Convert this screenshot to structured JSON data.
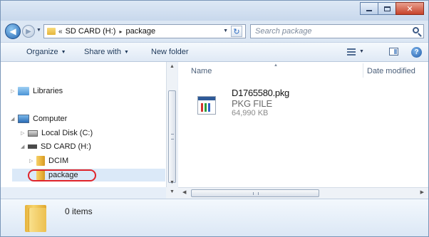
{
  "address": {
    "prefix": "«",
    "path": [
      "SD CARD (H:)",
      "package"
    ],
    "separator": "▸"
  },
  "search": {
    "placeholder": "Search package"
  },
  "toolbar": {
    "organize_label": "Organize",
    "share_label": "Share with",
    "new_folder_label": "New folder"
  },
  "nav": {
    "libraries": "Libraries",
    "computer": "Computer",
    "local_disk": "Local Disk (C:)",
    "sd_card": "SD CARD (H:)",
    "dcim": "DCIM",
    "package": "package"
  },
  "columns": {
    "name": "Name",
    "date_modified": "Date modified"
  },
  "file": {
    "name": "D1765580.pkg",
    "type": "PKG FILE",
    "size": "64,990 KB"
  },
  "details": {
    "count": "0 items"
  },
  "colors": {
    "highlight_ring": "#e0242a",
    "selection": "#dbe9f8"
  }
}
